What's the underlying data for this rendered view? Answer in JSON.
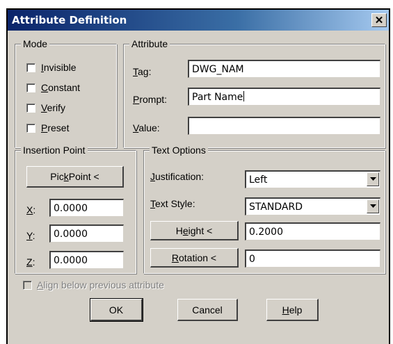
{
  "window": {
    "title": "Attribute Definition",
    "close_glyph": "✕"
  },
  "mode": {
    "label": "Mode",
    "options": [
      {
        "key": "I",
        "rest": "nvisible",
        "checked": false
      },
      {
        "key": "C",
        "rest": "onstant",
        "checked": false
      },
      {
        "key": "V",
        "rest": "erify",
        "checked": false
      },
      {
        "key": "P",
        "rest": "reset",
        "checked": false
      }
    ]
  },
  "attribute": {
    "label": "Attribute",
    "tag": {
      "key": "T",
      "rest": "ag:",
      "value": "DWG_NAM"
    },
    "prompt": {
      "key": "P",
      "rest": "rompt:",
      "value": "Part Name"
    },
    "value": {
      "key": "V",
      "rest": "alue:",
      "value": ""
    }
  },
  "insertion_point": {
    "label": "Insertion Point",
    "pick_button": {
      "before": "Pic",
      "key": "k",
      "after": " Point <"
    },
    "x": {
      "key": "X",
      "rest": ":",
      "value": "0.0000"
    },
    "y": {
      "key": "Y",
      "rest": ":",
      "value": "0.0000"
    },
    "z": {
      "key": "Z",
      "rest": ":",
      "value": "0.0000"
    }
  },
  "text_options": {
    "label": "Text Options",
    "justification": {
      "key": "J",
      "rest": "ustification:",
      "value": "Left"
    },
    "text_style": {
      "key": "T",
      "rest": "ext Style:",
      "value": "STANDARD"
    },
    "height_button": {
      "before": "H",
      "key": "e",
      "after": "ight <"
    },
    "height_value": "0.2000",
    "rotation_button": {
      "before": "",
      "key": "R",
      "after": "otation <"
    },
    "rotation_value": "0"
  },
  "align_below": {
    "key": "A",
    "rest": "lign below previous attribute",
    "checked": false,
    "enabled": false
  },
  "buttons": {
    "ok": "OK",
    "cancel": "Cancel",
    "help": {
      "key": "H",
      "rest": "elp"
    }
  }
}
